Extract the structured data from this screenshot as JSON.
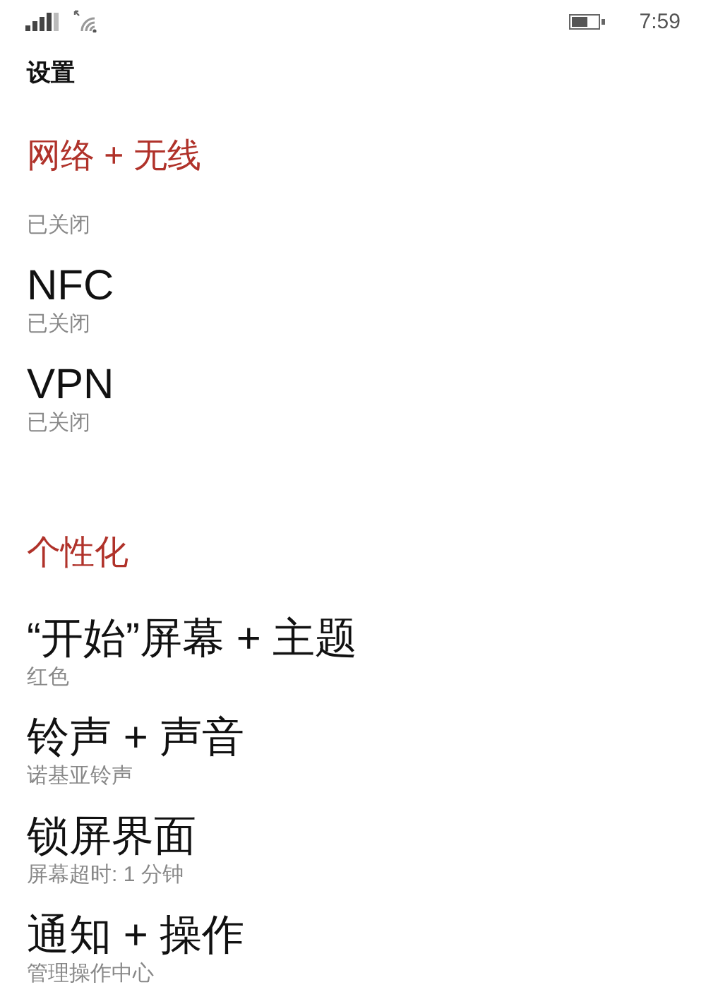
{
  "status_bar": {
    "time": "7:59"
  },
  "page_title": "设置",
  "sections": [
    {
      "header": "网络 + 无线",
      "items": [
        {
          "subtitle": "已关闭"
        },
        {
          "title": "NFC",
          "subtitle": "已关闭"
        },
        {
          "title": "VPN",
          "subtitle": "已关闭"
        }
      ]
    },
    {
      "header": "个性化",
      "items": [
        {
          "title": "“开始”屏幕 + 主题",
          "subtitle": "红色"
        },
        {
          "title": "铃声 + 声音",
          "subtitle": "诺基亚铃声"
        },
        {
          "title": "锁屏界面",
          "subtitle": "屏幕超时: 1 分钟"
        },
        {
          "title": "通知 + 操作",
          "subtitle": "管理操作中心"
        }
      ]
    }
  ]
}
